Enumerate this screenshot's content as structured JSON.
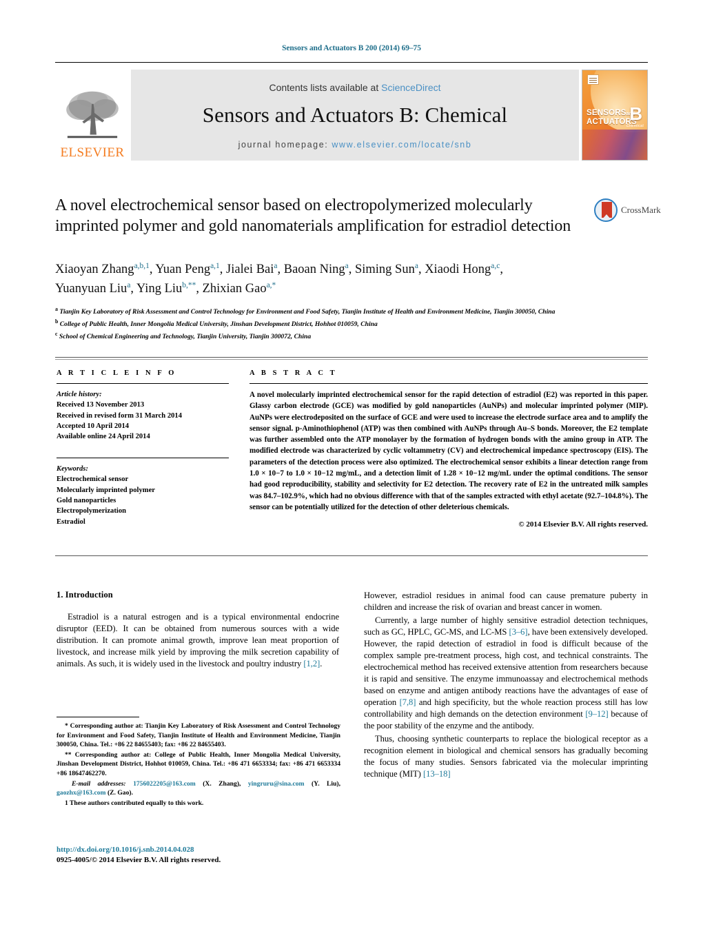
{
  "running_head": "Sensors and Actuators B 200 (2014) 69–75",
  "masthead": {
    "publisher_name": "ELSEVIER",
    "contents_prefix": "Contents lists available at ",
    "contents_link": "ScienceDirect",
    "journal_title": "Sensors and Actuators B: Chemical",
    "homepage_prefix": "journal homepage: ",
    "homepage_url": "www.elsevier.com/locate/snb",
    "cover": {
      "line1": "SENSORS",
      "and": "and",
      "line2": "ACTUATORS",
      "letter": "B",
      "sub": "Chemical"
    }
  },
  "article": {
    "title": "A novel electrochemical sensor based on electropolymerized molecularly imprinted polymer and gold nanomaterials amplification for estradiol detection",
    "crossmark_label": "CrossMark",
    "authors_line1": "Xiaoyan Zhang a,b,1, Yuan Peng a,1, Jialei Bai a, Baoan Ning a, Siming Sun a, Xiaodi Hong a,c,",
    "authors_line2": "Yuanyuan Liu a, Ying Liu b,**, Zhixian Gao a,*",
    "affiliations": [
      "a Tianjin Key Laboratory of Risk Assessment and Control Technology for Environment and Food Safety, Tianjin Institute of Health and Environment Medicine, Tianjin 300050, China",
      "b College of Public Health, Inner Mongolia Medical University, Jinshan Development District, Hohhot 010059, China",
      "c School of Chemical Engineering and Technology, Tianjin University, Tianjin 300072, China"
    ]
  },
  "article_info": {
    "heading": "A R T I C L E   I N F O",
    "history_label": "Article history:",
    "history": [
      "Received 13 November 2013",
      "Received in revised form 31 March 2014",
      "Accepted 10 April 2014",
      "Available online 24 April 2014"
    ],
    "keywords_label": "Keywords:",
    "keywords": [
      "Electrochemical sensor",
      "Molecularly imprinted polymer",
      "Gold nanoparticles",
      "Electropolymerization",
      "Estradiol"
    ]
  },
  "abstract": {
    "heading": "A B S T R A C T",
    "text": "A novel molecularly imprinted electrochemical sensor for the rapid detection of estradiol (E2) was reported in this paper. Glassy carbon electrode (GCE) was modified by gold nanoparticles (AuNPs) and molecular imprinted polymer (MIP). AuNPs were electrodeposited on the surface of GCE and were used to increase the electrode surface area and to amplify the sensor signal. p-Aminothiophenol (ATP) was then combined with AuNPs through Au–S bonds. Moreover, the E2 template was further assembled onto the ATP monolayer by the formation of hydrogen bonds with the amino group in ATP. The modified electrode was characterized by cyclic voltammetry (CV) and electrochemical impedance spectroscopy (EIS). The parameters of the detection process were also optimized. The electrochemical sensor exhibits a linear detection range from 1.0 × 10−7 to 1.0 × 10−12 mg/mL, and a detection limit of 1.28 × 10−12 mg/mL under the optimal conditions. The sensor had good reproducibility, stability and selectivity for E2 detection. The recovery rate of E2 in the untreated milk samples was 84.7–102.9%, which had no obvious difference with that of the samples extracted with ethyl acetate (92.7–104.8%). The sensor can be potentially utilized for the detection of other deleterious chemicals.",
    "copyright": "© 2014 Elsevier B.V. All rights reserved."
  },
  "body": {
    "section_heading": "1.  Introduction",
    "left_paragraph": "Estradiol is a natural estrogen and is a typical environmental endocrine disruptor (EED). It can be obtained from numerous sources with a wide distribution. It can promote animal growth, improve lean meat proportion of livestock, and increase milk yield by improving the milk secretion capability of animals. As such, it is widely used in the livestock and poultry industry [1,2].",
    "right_paragraphs": [
      "However, estradiol residues in animal food can cause premature puberty in children and increase the risk of ovarian and breast cancer in women.",
      "Currently, a large number of highly sensitive estradiol detection techniques, such as GC, HPLC, GC-MS, and LC-MS [3–6], have been extensively developed. However, the rapid detection of estradiol in food is difficult because of the complex sample pre-treatment process, high cost, and technical constraints. The electrochemical method has received extensive attention from researchers because it is rapid and sensitive. The enzyme immunoassay and electrochemical methods based on enzyme and antigen antibody reactions have the advantages of ease of operation [7,8] and high specificity, but the whole reaction process still has low controllability and high demands on the detection environment [9–12] because of the poor stability of the enzyme and the antibody.",
      "Thus, choosing synthetic counterparts to replace the biological receptor as a recognition element in biological and chemical sensors has gradually becoming the focus of many studies. Sensors fabricated via the molecular imprinting technique (MIT) [13–18]"
    ]
  },
  "footnotes": {
    "corr1": "* Corresponding author at: Tianjin Key Laboratory of Risk Assessment and Control Technology for Environment and Food Safety, Tianjin Institute of Health and Environment Medicine, Tianjin 300050, China. Tel.: +86 22 84655403; fax: +86 22 84655403.",
    "corr2": "** Corresponding author at: College of Public Health, Inner Mongolia Medical University, Jinshan Development District, Hohhot 010059, China. Tel.: +86 471 6653334; fax: +86 471 6653334 +86 18647462270.",
    "email_label": "E-mail addresses:",
    "email1": "1756022205@163.com",
    "email1_owner": "(X. Zhang),",
    "email2": "yingruru@sina.com",
    "email2_owner": "(Y. Liu),",
    "email3": "gaozhx@163.com",
    "email3_owner": "(Z. Gao).",
    "equal_contrib": "1 These authors contributed equally to this work."
  },
  "footer": {
    "doi": "http://dx.doi.org/10.1016/j.snb.2014.04.028",
    "issn": "0925-4005/© 2014 Elsevier B.V. All rights reserved."
  },
  "colors": {
    "link_blue": "#1f7a99",
    "sciencedirect_blue": "#4a90c4",
    "elsevier_orange": "#f47c20",
    "crossmark_blue": "#2e7fc1"
  }
}
